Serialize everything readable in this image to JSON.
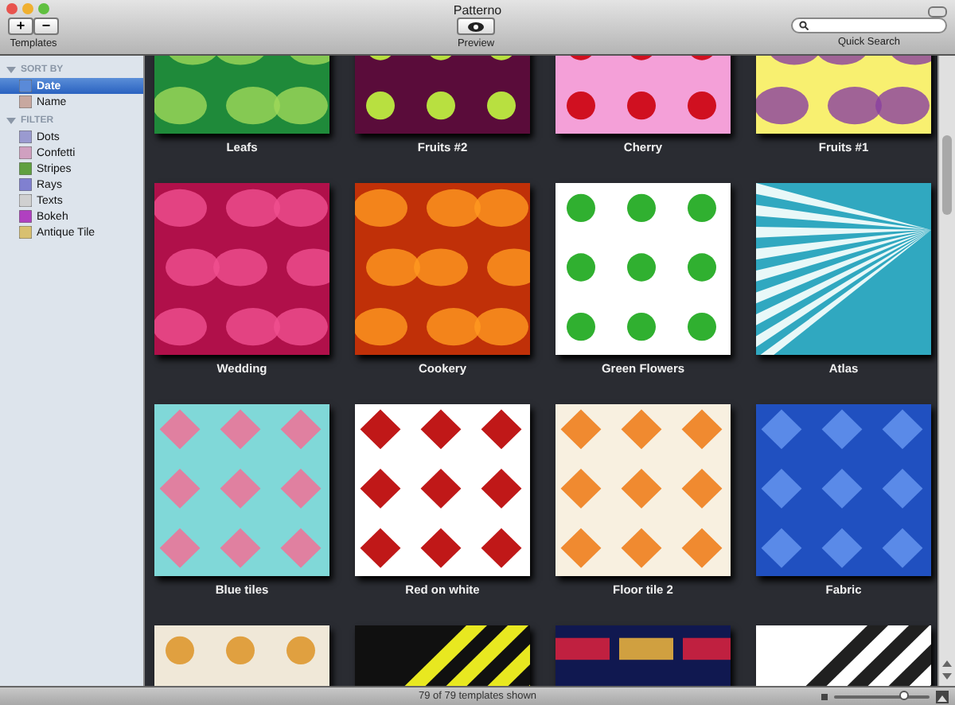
{
  "window": {
    "title": "Patterno"
  },
  "toolbar": {
    "templates_buttons": [
      "+",
      "−"
    ],
    "templates_label": "Templates",
    "preview_label": "Preview",
    "search_label": "Quick Search"
  },
  "sidebar": {
    "sections": [
      {
        "title": "SORT BY",
        "expanded": true,
        "items": [
          {
            "label": "Date",
            "selected": true
          },
          {
            "label": "Name",
            "selected": false
          }
        ]
      },
      {
        "title": "FILTER",
        "expanded": true,
        "items": [
          {
            "label": "Dots",
            "selected": false
          },
          {
            "label": "Confetti",
            "selected": false
          },
          {
            "label": "Stripes",
            "selected": false
          },
          {
            "label": "Rays",
            "selected": false
          },
          {
            "label": "Texts",
            "selected": false
          },
          {
            "label": "Bokeh",
            "selected": false
          },
          {
            "label": "Antique Tile",
            "selected": false
          }
        ]
      }
    ]
  },
  "templates": [
    {
      "kind": "picture",
      "name": "Leafs"
    },
    {
      "kind": "picture",
      "name": "Fruits #2"
    },
    {
      "kind": "picture",
      "name": "Cherry"
    },
    {
      "kind": "picture",
      "name": "Fruits #1"
    },
    {
      "kind": "picture",
      "name": "Wedding"
    },
    {
      "kind": "picture",
      "name": "Cookery"
    },
    {
      "kind": "picture",
      "name": "Green Flowers"
    },
    {
      "kind": "picture",
      "name": "Atlas"
    },
    {
      "kind": "picture",
      "name": "Blue tiles"
    },
    {
      "kind": "picture",
      "name": "Red on white"
    },
    {
      "kind": "picture",
      "name": "Floor tile 2"
    },
    {
      "kind": "picture",
      "name": "Fabric"
    },
    {
      "kind": "picture"
    },
    {
      "kind": "picture"
    },
    {
      "kind": "picture"
    },
    {
      "kind": "picture"
    }
  ],
  "status_bar": {
    "text": "79 of 79 templates shown",
    "zoom": {
      "level": 0.74
    }
  }
}
